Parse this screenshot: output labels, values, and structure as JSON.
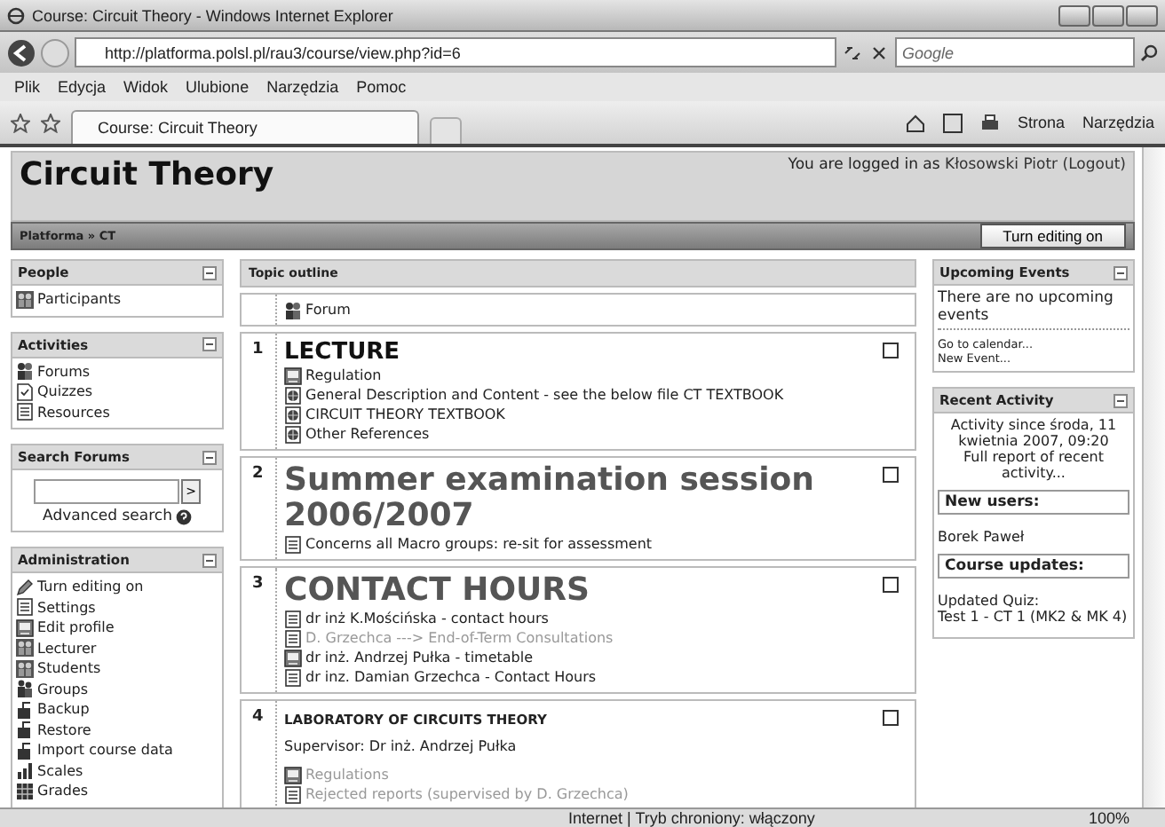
{
  "window": {
    "title": "Course: Circuit Theory - Windows Internet Explorer"
  },
  "address_bar": {
    "url": "http://platforma.polsl.pl/rau3/course/view.php?id=6",
    "search_placeholder": "Google"
  },
  "menu": [
    "Plik",
    "Edycja",
    "Widok",
    "Ulubione",
    "Narzędzia",
    "Pomoc"
  ],
  "tab": {
    "title": "Course: Circuit Theory"
  },
  "command_bar": [
    "Strona",
    "Narzędzia"
  ],
  "page": {
    "heading": "Circuit Theory",
    "login_prefix": "You are logged in as",
    "user": "Kłosowski Piotr",
    "logout": "(Logout)",
    "breadcrumb": "Platforma » CT",
    "edit_button": "Turn editing on"
  },
  "left_blocks": [
    {
      "kind": "links",
      "title": "People",
      "items": [
        {
          "label": "Participants",
          "kind": "people"
        }
      ]
    },
    {
      "kind": "links",
      "title": "Activities",
      "items": [
        {
          "label": "Forums",
          "kind": "forum"
        },
        {
          "label": "Quizzes",
          "kind": "quiz"
        },
        {
          "label": "Resources",
          "kind": "doc"
        }
      ]
    },
    {
      "kind": "search",
      "title": "Search Forums",
      "button": ">",
      "link": "Advanced search"
    },
    {
      "kind": "links",
      "title": "Administration",
      "items": [
        {
          "label": "Turn editing on",
          "kind": "pen"
        },
        {
          "label": "Settings",
          "kind": "doc"
        },
        {
          "label": "Edit profile",
          "kind": "book"
        },
        {
          "label": "Lecturer",
          "kind": "people"
        },
        {
          "label": "Students",
          "kind": "people"
        },
        {
          "label": "Groups",
          "kind": "groups"
        },
        {
          "label": "Backup",
          "kind": "backup"
        },
        {
          "label": "Restore",
          "kind": "backup"
        },
        {
          "label": "Import course data",
          "kind": "backup"
        },
        {
          "label": "Scales",
          "kind": "scales"
        },
        {
          "label": "Grades",
          "kind": "grades"
        }
      ]
    }
  ],
  "topic_outline": {
    "title": "Topic outline",
    "sections": [
      {
        "kind": "plain",
        "items": [
          {
            "label": "Forum",
            "kind": "forum",
            "dimmed": false
          }
        ]
      },
      {
        "number": "1",
        "title": "LECTURE",
        "kind": "large",
        "highlighted": false,
        "items": [
          {
            "label": "Regulation",
            "kind": "book",
            "dimmed": false
          },
          {
            "label": "General Description and Content - see the below file CT TEXTBOOK",
            "kind": "web",
            "dimmed": false
          },
          {
            "label": "CIRCUIT THEORY TEXTBOOK",
            "kind": "web",
            "dimmed": false
          },
          {
            "label": "Other References",
            "kind": "web",
            "dimmed": false
          }
        ]
      },
      {
        "number": "2",
        "title": "Summer examination session 2006/2007",
        "kind": "huge",
        "highlighted": false,
        "items": [
          {
            "label": "Concerns all Macro groups: re-sit for assessment",
            "kind": "doc",
            "dimmed": false
          }
        ]
      },
      {
        "number": "3",
        "title": "CONTACT HOURS",
        "kind": "huge",
        "highlighted": false,
        "items": [
          {
            "label": "dr inż K.Mościńska - contact hours",
            "kind": "doc",
            "dimmed": false
          },
          {
            "label": "D. Grzechca ---> End-of-Term Consultations",
            "kind": "doc",
            "dimmed": true
          },
          {
            "label": "dr inż. Andrzej Pułka - timetable",
            "kind": "book",
            "dimmed": false
          },
          {
            "label": "dr inz. Damian Grzechca - Contact Hours",
            "kind": "doc",
            "dimmed": false
          }
        ]
      },
      {
        "number": "4",
        "title": "LABORATORY OF CIRCUITS THEORY",
        "kind": "small",
        "highlighted": false,
        "summary": "Supervisor: Dr inż. Andrzej Pułka",
        "items": [
          {
            "label": "Regulations",
            "kind": "book",
            "dimmed": true
          },
          {
            "label": "Rejected reports (supervised by D. Grzechca)",
            "kind": "doc",
            "dimmed": true
          }
        ]
      }
    ]
  },
  "right_blocks": [
    {
      "kind": "events",
      "title": "Upcoming Events",
      "text": "There are no upcoming events",
      "links": [
        "Go to calendar...",
        "New Event..."
      ]
    },
    {
      "kind": "activity",
      "title": "Recent Activity",
      "since": "Activity since środa, 11 kwietnia 2007, 09:20",
      "report": "Full report of recent activity...",
      "groups": [
        {
          "heading": "New users:",
          "text": "Borek Paweł"
        },
        {
          "heading": "Course updates:",
          "text": "Updated Quiz:\nTest 1 - CT 1 (MK2 & MK 4)"
        }
      ]
    }
  ],
  "status_bar": {
    "zone": "Internet | Tryb chroniony: włączony",
    "zoom": "100%"
  }
}
